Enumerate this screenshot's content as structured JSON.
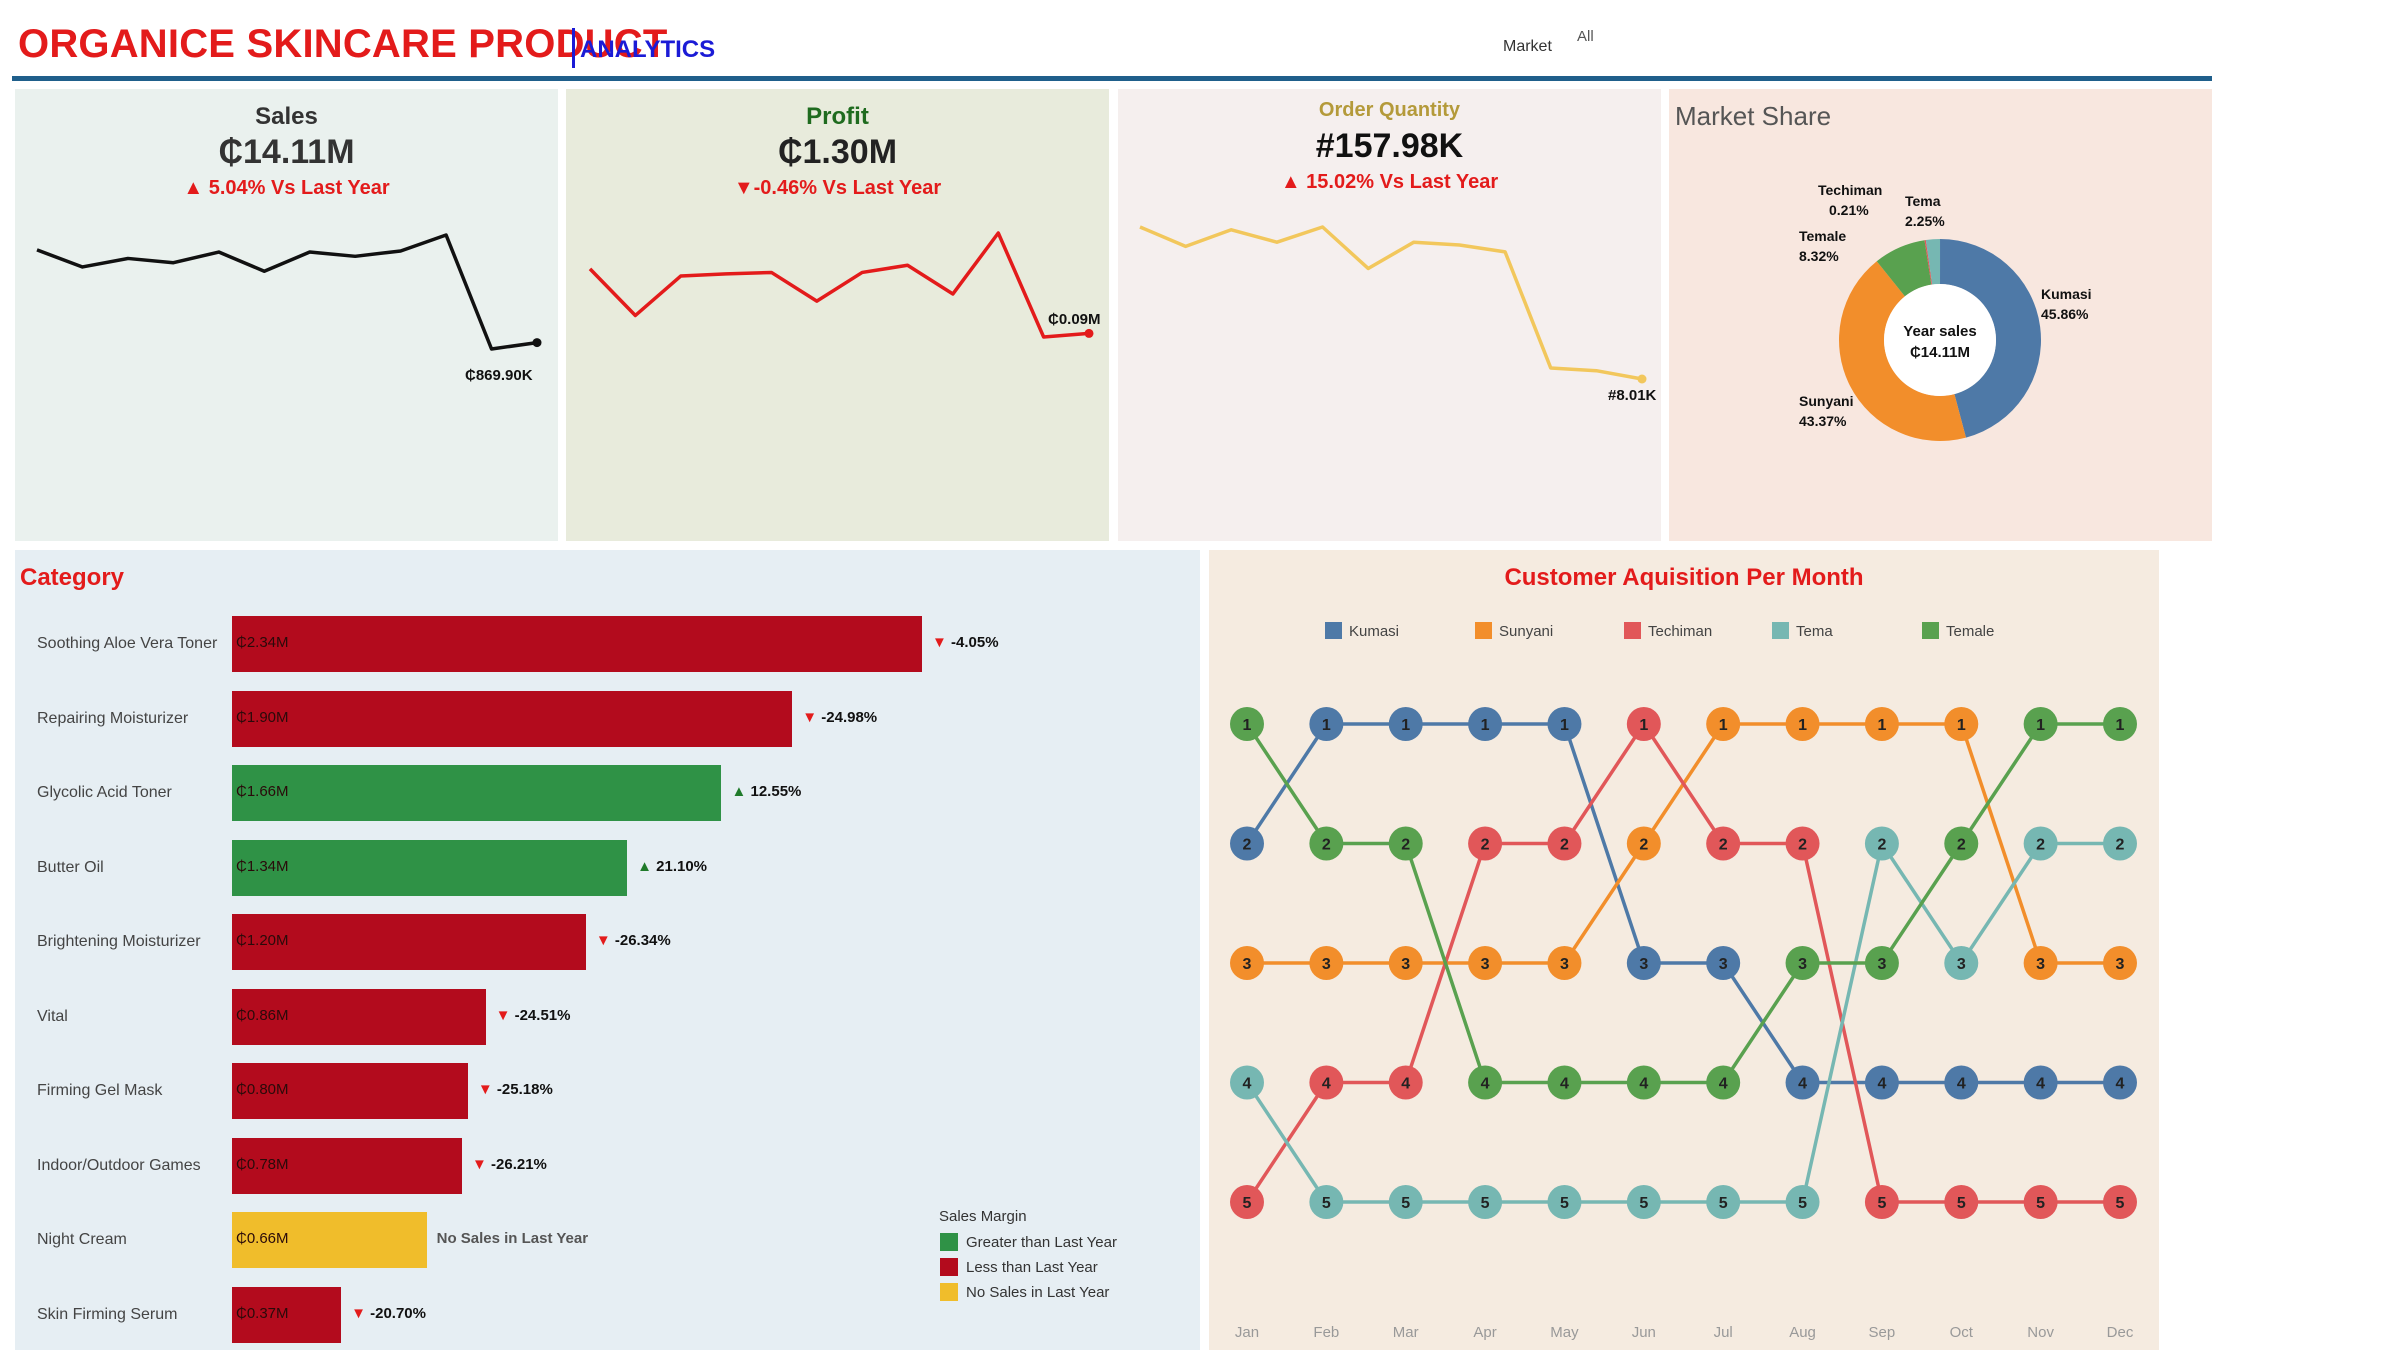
{
  "header": {
    "title": "ORGANICE SKINCARE PRODUCT",
    "subtitle": "ANALYTICS",
    "filter_label": "Market",
    "filter_value": "All"
  },
  "kpis": {
    "sales": {
      "title": "Sales",
      "value": "₵14.11M",
      "delta": "▲ 5.04% Vs Last Year",
      "end_label": "₵869.90K",
      "trend": [
        10.2,
        8.6,
        9.4,
        9.0,
        10.0,
        8.2,
        10.0,
        9.6,
        10.1,
        11.6,
        0.9,
        1.5
      ],
      "color": "#111111",
      "bg": "#eaf1ee"
    },
    "profit": {
      "title": "Profit",
      "value": "₵1.30M",
      "delta": "▼-0.46% Vs Last Year",
      "end_label": "₵0.09M",
      "trend": [
        0.155,
        0.09,
        0.145,
        0.148,
        0.15,
        0.11,
        0.15,
        0.16,
        0.12,
        0.205,
        0.06,
        0.065
      ],
      "color": "#e31b1b",
      "bg": "#e8ebdc"
    },
    "orders": {
      "title": "Order Quantity",
      "value": "#157.98K",
      "delta": "▲ 15.02% Vs Last Year",
      "end_label": "#8.01K",
      "trend": [
        19.0,
        17.6,
        18.8,
        17.9,
        19.0,
        16.0,
        17.9,
        17.7,
        17.2,
        8.8,
        8.6,
        8.0
      ],
      "color": "#f2c75c",
      "bg": "#f5efee"
    }
  },
  "market_share": {
    "title": "Market Share",
    "center_line1": "Year sales",
    "center_line2": "₵14.11M",
    "bg": "#f8e7df",
    "slices": [
      {
        "name": "Kumasi",
        "pct": 45.86,
        "label": "45.86%",
        "color": "#4e79a7"
      },
      {
        "name": "Sunyani",
        "pct": 43.37,
        "label": "43.37%",
        "color": "#f28e2b"
      },
      {
        "name": "Temale",
        "pct": 8.32,
        "label": "8.32%",
        "color": "#59a14f"
      },
      {
        "name": "Techiman",
        "pct": 0.21,
        "label": "0.21%",
        "color": "#e15759"
      },
      {
        "name": "Tema",
        "pct": 2.25,
        "label": "2.25%",
        "color": "#76b7b2"
      }
    ]
  },
  "category": {
    "title": "Category",
    "bg": "#e6eef3",
    "rows": [
      {
        "name": "Soothing Aloe Vera Toner",
        "value": 2.34,
        "label": "₵2.34M",
        "delta": "-4.05%",
        "dir": "down",
        "status": "less"
      },
      {
        "name": "Repairing Moisturizer",
        "value": 1.9,
        "label": "₵1.90M",
        "delta": "-24.98%",
        "dir": "down",
        "status": "less"
      },
      {
        "name": "Glycolic Acid Toner",
        "value": 1.66,
        "label": "₵1.66M",
        "delta": "12.55%",
        "dir": "up",
        "status": "greater"
      },
      {
        "name": "Butter Oil",
        "value": 1.34,
        "label": "₵1.34M",
        "delta": "21.10%",
        "dir": "up",
        "status": "greater"
      },
      {
        "name": "Brightening Moisturizer",
        "value": 1.2,
        "label": "₵1.20M",
        "delta": "-26.34%",
        "dir": "down",
        "status": "less"
      },
      {
        "name": "Vital",
        "value": 0.86,
        "label": "₵0.86M",
        "delta": "-24.51%",
        "dir": "down",
        "status": "less"
      },
      {
        "name": "Firming Gel Mask",
        "value": 0.8,
        "label": "₵0.80M",
        "delta": "-25.18%",
        "dir": "down",
        "status": "less"
      },
      {
        "name": "Indoor/Outdoor Games",
        "value": 0.78,
        "label": "₵0.78M",
        "delta": "-26.21%",
        "dir": "down",
        "status": "less"
      },
      {
        "name": "Night Cream",
        "value": 0.66,
        "label": "₵0.66M",
        "delta": "No Sales in Last Year",
        "dir": "none",
        "status": "none"
      },
      {
        "name": "Skin Firming Serum",
        "value": 0.37,
        "label": "₵0.37M",
        "delta": "-20.70%",
        "dir": "down",
        "status": "less"
      }
    ],
    "legend": {
      "title": "Sales Margin",
      "items": [
        {
          "label": "Greater than Last Year",
          "color": "#2f9246"
        },
        {
          "label": "Less than Last Year",
          "color": "#b30b1d"
        },
        {
          "label": "No Sales in Last Year",
          "color": "#f0bd2b"
        }
      ]
    }
  },
  "acquisition": {
    "title": "Customer Aquisition Per Month",
    "bg": "#f5ebe0",
    "months": [
      "Jan",
      "Feb",
      "Mar",
      "Apr",
      "May",
      "Jun",
      "Jul",
      "Aug",
      "Sep",
      "Oct",
      "Nov",
      "Dec"
    ],
    "series": [
      {
        "name": "Kumasi",
        "color": "#4e79a7",
        "ranks": [
          2,
          1,
          1,
          1,
          1,
          3,
          3,
          4,
          4,
          4,
          4,
          4
        ]
      },
      {
        "name": "Sunyani",
        "color": "#f28e2b",
        "ranks": [
          3,
          3,
          3,
          3,
          3,
          2,
          1,
          1,
          1,
          1,
          3,
          3
        ]
      },
      {
        "name": "Techiman",
        "color": "#e15759",
        "ranks": [
          5,
          4,
          4,
          2,
          2,
          1,
          2,
          2,
          5,
          5,
          5,
          5
        ]
      },
      {
        "name": "Tema",
        "color": "#76b7b2",
        "ranks": [
          4,
          5,
          5,
          5,
          5,
          5,
          5,
          5,
          2,
          3,
          2,
          2
        ]
      },
      {
        "name": "Temale",
        "color": "#59a14f",
        "ranks": [
          1,
          2,
          2,
          4,
          4,
          4,
          4,
          3,
          3,
          2,
          1,
          1
        ]
      }
    ]
  }
}
